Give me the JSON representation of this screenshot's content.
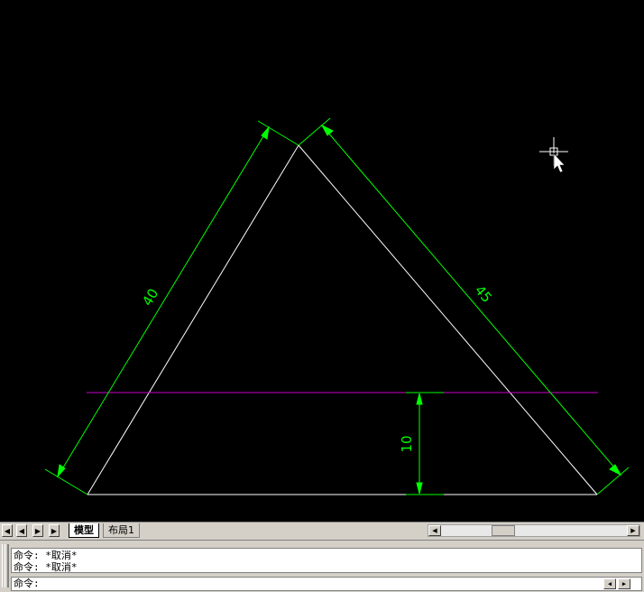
{
  "drawing": {
    "dim_left": "40",
    "dim_right": "45",
    "dim_vertical": "10",
    "colors": {
      "geometry": "#ffffff",
      "dimension": "#00ff00",
      "construction_line": "#cc00cc",
      "background": "#000000"
    }
  },
  "tabs": [
    {
      "label": "模型",
      "active": true
    },
    {
      "label": "布局1",
      "active": false
    }
  ],
  "command": {
    "history": [
      "命令:  *取消*",
      "命令:  *取消*"
    ],
    "prompt": "命令:"
  },
  "icons": {
    "nav_first": "first-tab-icon",
    "nav_prev": "prev-tab-icon",
    "nav_next": "next-tab-icon",
    "nav_last": "last-tab-icon",
    "cursor": "crosshair-cursor-icon"
  }
}
